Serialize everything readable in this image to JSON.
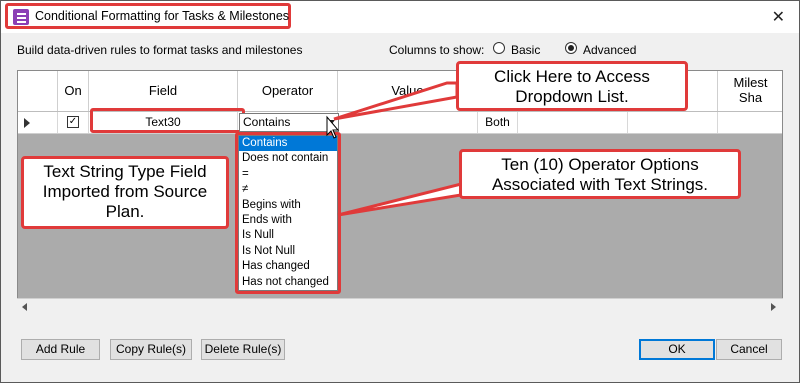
{
  "window": {
    "title": "Conditional Formatting for Tasks & Milestones",
    "close_glyph": "✕"
  },
  "description": "Build data-driven rules to format tasks and milestones",
  "columns_to_show": {
    "label": "Columns to show:",
    "options": [
      {
        "label": "Basic",
        "selected": false
      },
      {
        "label": "Advanced",
        "selected": true
      }
    ]
  },
  "grid": {
    "headers": {
      "on": "On",
      "field": "Field",
      "operator": "Operator",
      "value": "Value",
      "milestone": "Milest",
      "shape": "Sha"
    },
    "row": {
      "checked_glyph": "✓",
      "field": "Text30",
      "operator": "Contains",
      "applies_to": "Both"
    }
  },
  "dropdown": {
    "options": [
      "Contains",
      "Does not contain",
      "=",
      "≠",
      "Begins with",
      "Ends with",
      "Is Null",
      "Is Not Null",
      "Has changed",
      "Has not changed"
    ],
    "selected_index": 0
  },
  "callouts": {
    "dropdown_hint": "Click Here to Access Dropdown List.",
    "operator_options": "Ten (10) Operator Options Associated with Text Strings.",
    "field_type": "Text String Type Field Imported from Source Plan."
  },
  "buttons": {
    "add_rule": "Add Rule",
    "copy_rule": "Copy Rule(s)",
    "delete_rule": "Delete Rule(s)",
    "ok": "OK",
    "cancel": "Cancel"
  },
  "colors": {
    "callout_border": "#e03a3a",
    "selection": "#0078d7",
    "grid_background": "#ababab"
  }
}
